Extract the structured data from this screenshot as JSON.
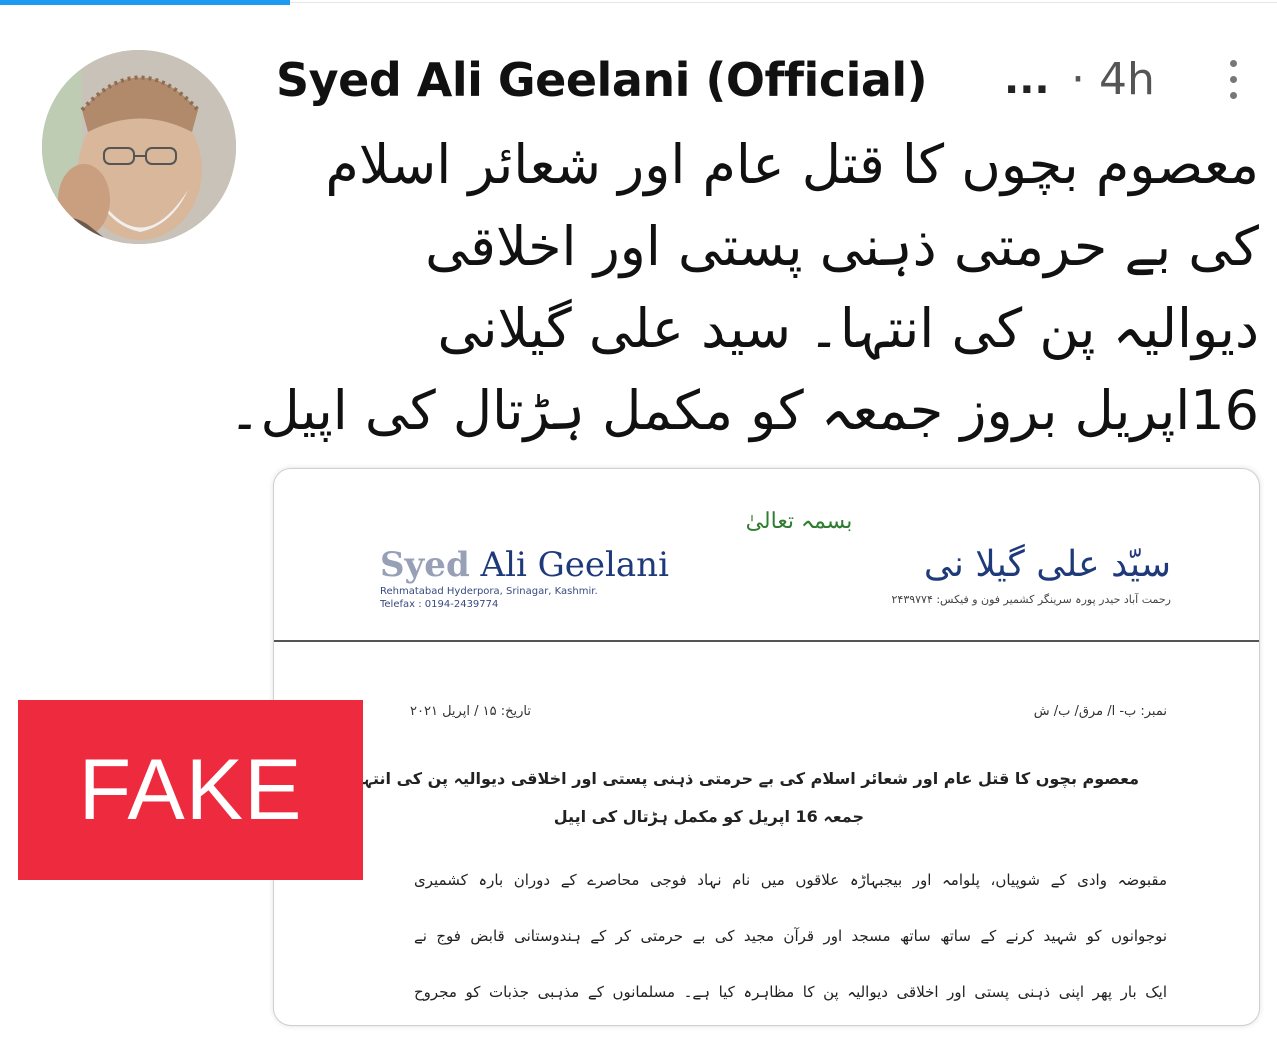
{
  "post": {
    "author_name": "Syed Ali Geelani (Official)",
    "ellipsis": "...",
    "time": "· 4h",
    "text_lines": [
      "معصوم بچوں کا قتل عام اور شعائر اسلام",
      "کی بے حرمتی ذہنی پستی اور اخلاقی",
      "دیوالیہ پن کی انتہا۔ سید علی گیلانی",
      "16اپریل بروز جمعہ کو مکمل ہڑتال کی اپیل۔"
    ]
  },
  "document": {
    "bismillah": "بسمہ تعالیٰ",
    "name_en_part1": "Syed",
    "name_en_part2": " Ali Geelani",
    "address_en": "Rehmatabad Hyderpora, Srinagar, Kashmir.",
    "telefax_en": "Telefax : 0194-2439774",
    "name_ur": "سیّد علی گیلا نی",
    "address_ur": "رحمت آباد حیدر پورہ سرینگر کشمیر فون و فیکس: ۲۴۳۹۷۷۴",
    "reference": "نمبر: ب- ا/ مرق/ ب/ ش",
    "date": "تاریخ: ۱۵ / اپریل ۲۰۲۱",
    "bold_lines": [
      "معصوم بچوں کا قتل عام اور شعائر اسلام کی بے حرمتی ذہنی پستی اور اخلاقی دیوالیہ پن کی انتہا۔ سید علی گیلانی۔",
      "جمعہ 16 اپریل کو مکمل ہڑتال کی اپیل"
    ],
    "body_lines": [
      "مقبوضہ وادی کے شوپیاں، پلوامہ اور بیجبہاڑہ علاقوں میں نام نہاد فوجی محاصرے کے دوران بارہ کشمیری",
      "نوجوانوں کو شہید کرنے کے ساتھ ساتھ مسجد اور قرآن مجید کی بے حرمتی کر کے ہندوستانی قابض فوج نے",
      "ایک بار پھر اپنی ذہنی پستی اور اخلاقی دیوالیہ پن کا مظاہرہ کیا ہے۔ مسلمانوں کے مذہبی جذبات کو مجروح"
    ]
  },
  "badge": {
    "label": "FAKE",
    "color": "#ee2a3e"
  },
  "colors": {
    "accent": "#1d9bf0",
    "letterhead_blue": "#1f3a7a",
    "bismillah_green": "#2f7d2f"
  }
}
